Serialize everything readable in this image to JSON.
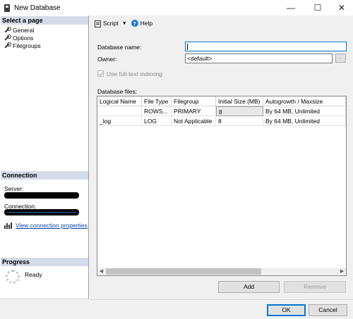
{
  "window": {
    "title": "New Database",
    "minimize_glyph": "—",
    "maximize_glyph": "☐",
    "close_glyph": "✕"
  },
  "sidebar": {
    "select_page_header": "Select a page",
    "pages": [
      {
        "label": "General",
        "icon": "wrench-icon"
      },
      {
        "label": "Options",
        "icon": "wrench-icon"
      },
      {
        "label": "Filegroups",
        "icon": "wrench-icon"
      }
    ],
    "connection_header": "Connection",
    "server_label": "Server:",
    "connection_label": "Connection:",
    "view_properties_link": "View connection properties",
    "progress_header": "Progress",
    "progress_status": "Ready"
  },
  "toolbar": {
    "script_label": "Script",
    "caret": "▼",
    "help_label": "Help",
    "help_glyph": "?"
  },
  "form": {
    "database_name_label": "Database name:",
    "database_name_value": "",
    "owner_label": "Owner:",
    "owner_value": "<default>",
    "browse_label": "...",
    "fulltext_label": "Use full-text indexing",
    "fulltext_checked": true,
    "database_files_label": "Database files:"
  },
  "files_table": {
    "columns": [
      "Logical Name",
      "File Type",
      "Filegroup",
      "Initial Size (MB)",
      "Autogrowth / Maxsize"
    ],
    "rows": [
      [
        "",
        "ROWS...",
        "PRIMARY",
        "8",
        "By 64 MB, Unlimited"
      ],
      [
        "_log",
        "LOG",
        "Not Applicable",
        "8",
        "By 64 MB, Unlimited"
      ]
    ],
    "scroll_left": "◀",
    "scroll_right": "▶"
  },
  "buttons": {
    "add": "Add",
    "remove": "Remove",
    "ok": "OK",
    "cancel": "Cancel"
  },
  "colors": {
    "section_header": "#d6dbe9",
    "link": "#0645ad",
    "focus": "#0078d7"
  }
}
